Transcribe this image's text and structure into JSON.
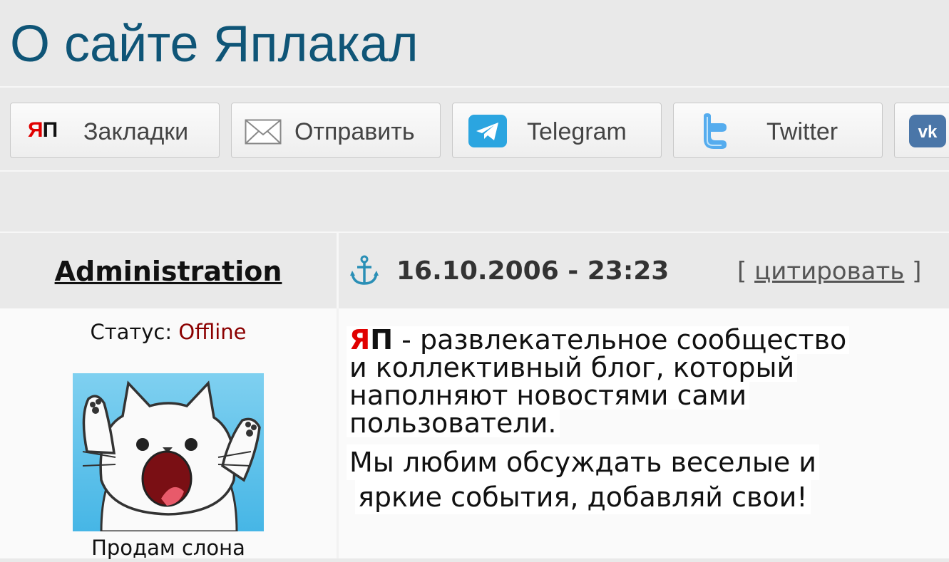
{
  "page": {
    "title": "О сайте Яплакал"
  },
  "share": {
    "buttons": [
      {
        "label": "Закладки",
        "icon": "yp-logo-icon"
      },
      {
        "label": "Отправить",
        "icon": "envelope-icon"
      },
      {
        "label": "Telegram",
        "icon": "telegram-icon"
      },
      {
        "label": "Twitter",
        "icon": "twitter-icon"
      },
      {
        "label": "",
        "icon": "vk-icon"
      }
    ],
    "logo_text": {
      "red": "Я",
      "black": "П"
    }
  },
  "post": {
    "author": "Administration",
    "date": "16.10.2006 - 23:23",
    "quote_open": "[ ",
    "quote_label": "цитировать",
    "quote_close": " ]",
    "status_label": "Статус: ",
    "status_value": "Offline",
    "user_title": "Продам слона",
    "body": {
      "brand_red": "Я",
      "brand_black": "П",
      "line1_rest": " - развлекательное сообщество",
      "line2": "и коллективный блог, который",
      "line3": "наполняют новостями сами",
      "line4": "пользователи.",
      "line5": "Мы любим обсуждать веселые и",
      "line6": "яркие события, добавляй свои!"
    }
  },
  "colors": {
    "title": "#0f5577",
    "brand_red": "#e00000",
    "offline": "#8b0000",
    "telegram": "#2ba5e0",
    "twitter": "#55acee",
    "vk": "#4a76a8"
  }
}
